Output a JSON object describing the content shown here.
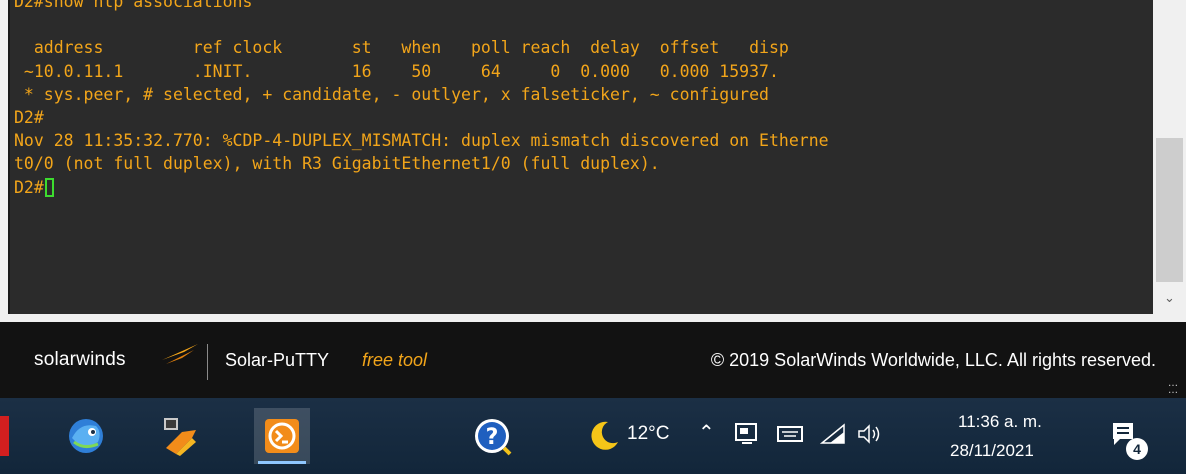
{
  "terminal": {
    "lines": [
      "D2#show ntp associations",
      "",
      "  address         ref clock       st   when   poll reach  delay  offset   disp",
      " ~10.0.11.1       .INIT.          16    50     64     0  0.000   0.000 15937.",
      " * sys.peer, # selected, + candidate, - outlyer, x falseticker, ~ configured",
      "D2#",
      "Nov 28 11:35:32.770: %CDP-4-DUPLEX_MISMATCH: duplex mismatch discovered on Etherne",
      "t0/0 (not full duplex), with R3 GigabitEthernet1/0 (full duplex)."
    ],
    "prompt": "D2#",
    "text_color": "#f2a51a",
    "background_color": "#2b2b2b",
    "cursor_color": "#3ddc2f"
  },
  "brand": {
    "logo_text": "solarwinds",
    "product": "Solar-PuTTY",
    "tag": "free tool",
    "copyright": "© 2019 SolarWinds Worldwide, LLC. All rights reserved.",
    "accent_color": "#f2a51a"
  },
  "taskbar": {
    "apps": [
      {
        "icon": "gns3-chameleon-icon"
      },
      {
        "icon": "vmware-workstation-icon"
      },
      {
        "icon": "solar-putty-icon",
        "active": true
      },
      {
        "icon": "help-icon"
      }
    ],
    "weather": {
      "icon": "moon-icon",
      "temperature": "12°C"
    },
    "tray_icons": [
      "chevron-up-icon",
      "network-status-icon",
      "keyboard-icon",
      "wifi-icon",
      "speaker-icon"
    ],
    "clock": {
      "time": "11:36 a. m.",
      "date": "28/11/2021"
    },
    "notifications": {
      "icon": "action-center-icon",
      "count": "4"
    }
  }
}
